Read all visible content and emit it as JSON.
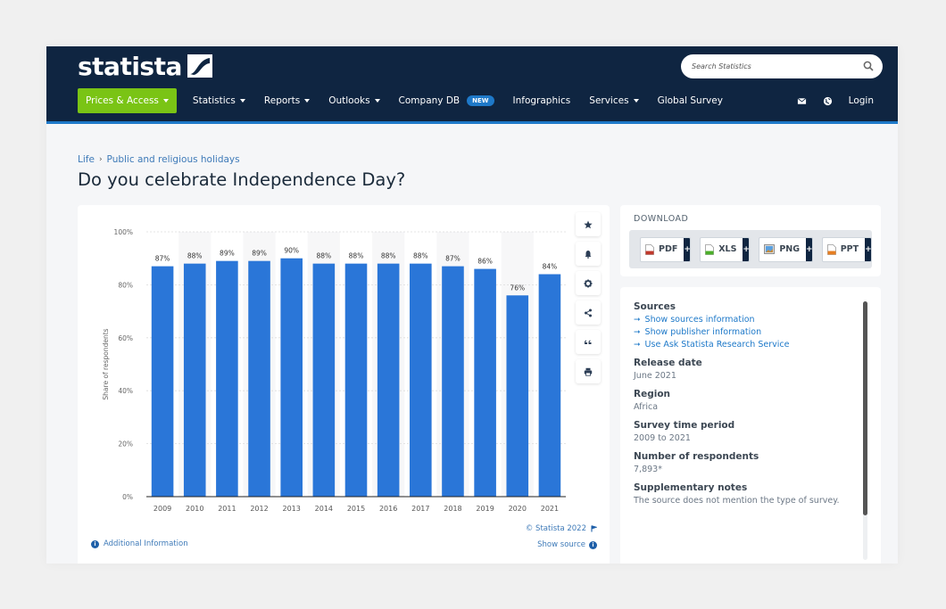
{
  "header": {
    "logo_text": "statista",
    "search_placeholder": "Search Statistics",
    "nav": [
      {
        "label": "Prices & Access",
        "dropdown": true,
        "primary": true
      },
      {
        "label": "Statistics",
        "dropdown": true
      },
      {
        "label": "Reports",
        "dropdown": true
      },
      {
        "label": "Outlooks",
        "dropdown": true
      },
      {
        "label": "Company DB",
        "badge": "NEW"
      },
      {
        "label": "Infographics"
      },
      {
        "label": "Services",
        "dropdown": true
      },
      {
        "label": "Global Survey"
      }
    ],
    "login_label": "Login",
    "icons": [
      "mail-icon",
      "globe-icon"
    ]
  },
  "breadcrumb": {
    "items": [
      "Life",
      "Public and religious holidays"
    ],
    "separator": "›"
  },
  "page_title": "Do you celebrate Independence Day?",
  "chart_tools": [
    "star-icon",
    "bell-icon",
    "gear-icon",
    "share-icon",
    "quote-icon",
    "print-icon"
  ],
  "chart_footer": {
    "copyright": "© Statista 2022",
    "show_source": "Show source",
    "additional_info": "Additional Information"
  },
  "colors": {
    "header_bg": "#0f2541",
    "accent_green": "#7ac415",
    "bar_blue": "#2a76d8",
    "link_blue": "#1e79c9"
  },
  "chart_data": {
    "type": "bar",
    "title": "",
    "xlabel": "",
    "ylabel": "Share of respondents",
    "categories": [
      "2009",
      "2010",
      "2011",
      "2012",
      "2013",
      "2014",
      "2015",
      "2016",
      "2017",
      "2018",
      "2019",
      "2020",
      "2021"
    ],
    "values": [
      87,
      88,
      89,
      89,
      90,
      88,
      88,
      88,
      88,
      87,
      86,
      76,
      84
    ],
    "value_labels": [
      "87%",
      "88%",
      "89%",
      "89%",
      "90%",
      "88%",
      "88%",
      "88%",
      "88%",
      "87%",
      "86%",
      "76%",
      "84%"
    ],
    "ylim": [
      0,
      100
    ],
    "yticks": [
      0,
      20,
      40,
      60,
      80,
      100
    ],
    "ytick_labels": [
      "0%",
      "20%",
      "40%",
      "60%",
      "80%",
      "100%"
    ],
    "grid": true,
    "legend": "none"
  },
  "download": {
    "title": "DOWNLOAD",
    "buttons": [
      {
        "label": "PDF",
        "icon": "pdf-file-icon",
        "color": "#c0392b"
      },
      {
        "label": "XLS",
        "icon": "xls-file-icon",
        "color": "#4caf2a"
      },
      {
        "label": "PNG",
        "icon": "png-file-icon",
        "color": "#2a76d8"
      },
      {
        "label": "PPT",
        "icon": "ppt-file-icon",
        "color": "#e67e22"
      }
    ]
  },
  "info": {
    "sources_heading": "Sources",
    "source_links": [
      "Show sources information",
      "Show publisher information",
      "Use Ask Statista Research Service"
    ],
    "fields": [
      {
        "heading": "Release date",
        "value": "June 2021"
      },
      {
        "heading": "Region",
        "value": "Africa"
      },
      {
        "heading": "Survey time period",
        "value": "2009 to 2021"
      },
      {
        "heading": "Number of respondents",
        "value": "7,893*"
      },
      {
        "heading": "Supplementary notes",
        "value": "The source does not mention the type of survey."
      }
    ]
  }
}
